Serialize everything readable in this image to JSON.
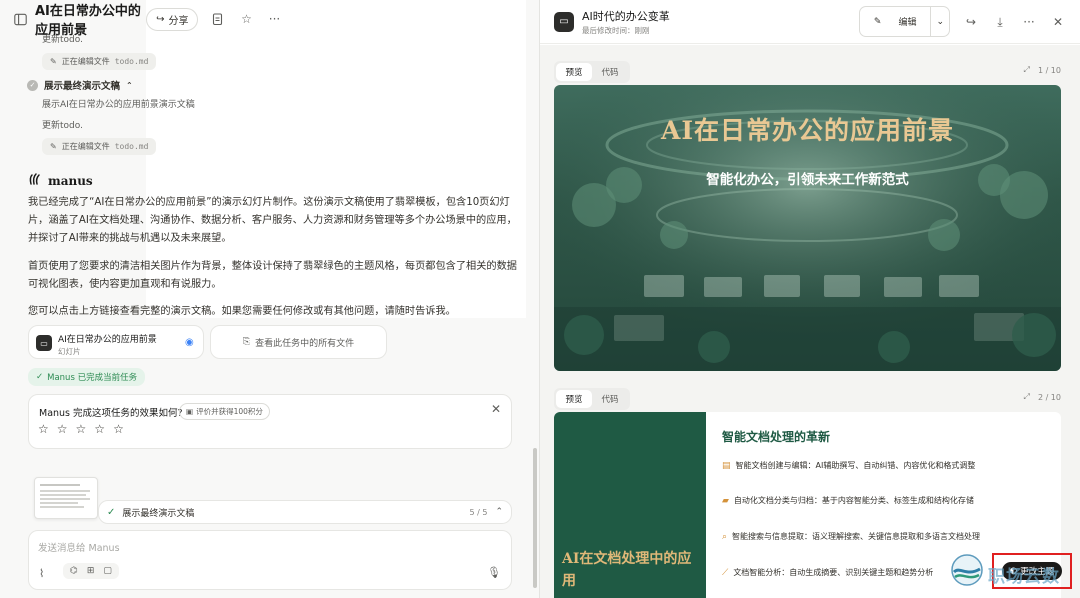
{
  "left_header": {
    "title": "AI在日常办公中的应用前景",
    "share_label": "分享"
  },
  "steps": {
    "update_todo_1": "更新todo.",
    "editing_label_1": "正在编辑文件",
    "editing_file_1": "todo.md",
    "step_title": "展示最终演示文稿",
    "step_desc": "展示AI在日常办公的应用前景演示文稿",
    "update_todo_2": "更新todo.",
    "editing_label_2": "正在编辑文件",
    "editing_file_2": "todo.md"
  },
  "manus_name": "manus",
  "message": {
    "p1": "我已经完成了“AI在日常办公的应用前景”的演示幻灯片制作。这份演示文稿使用了翡翠模板，包含10页幻灯片，涵盖了AI在文档处理、沟通协作、数据分析、客户服务、人力资源和财务管理等多个办公场景中的应用，并探讨了AI带来的挑战与机遇以及未来展望。",
    "p2": "首页使用了您要求的清洁相关图片作为背景，整体设计保持了翡翠绿色的主题风格，每页都包含了相关的数据可视化图表，使内容更加直观和有说服力。",
    "p3": "您可以点击上方链接查看完整的演示文稿。如果您需要任何修改或有其他问题，请随时告诉我。"
  },
  "attachment": {
    "name": "AI在日常办公的应用前景",
    "type": "幻灯片",
    "view_all": "查看此任务中的所有文件"
  },
  "done_badge": "Manus 已完成当前任务",
  "rating": {
    "question": "Manus 完成这项任务的效果如何?",
    "reward": "评价并获得100积分",
    "stars": 5
  },
  "progress": {
    "label": "展示最终演示文稿",
    "count": "5 / 5"
  },
  "input": {
    "placeholder": "发送消息给 Manus"
  },
  "right_header": {
    "title": "AI时代的办公变革",
    "subtitle": "最后修改时间：刚刚",
    "edit_label": "编辑"
  },
  "slides": [
    {
      "tab_preview": "预览",
      "tab_code": "代码",
      "page": "1 / 10",
      "title": "AI在日常办公的应用前景",
      "subtitle": "智能化办公，引领未来工作新范式"
    },
    {
      "tab_preview": "预览",
      "tab_code": "代码",
      "page": "2 / 10",
      "left_title": "AI在文档处理中的应用",
      "title": "智能文档处理的革新",
      "items": [
        "智能文档创建与编辑：AI辅助撰写、自动纠错、内容优化和格式调整",
        "自动化文档分类与归档：基于内容智能分类、标签生成和结构化存储",
        "智能搜索与信息提取：语义理解搜索、关键信息提取和多语言文档处理",
        "文档智能分析：自动生成摘要、识别关键主题和趋势分析"
      ]
    }
  ],
  "theme_button": "更改主题",
  "watermark": "职场云数"
}
